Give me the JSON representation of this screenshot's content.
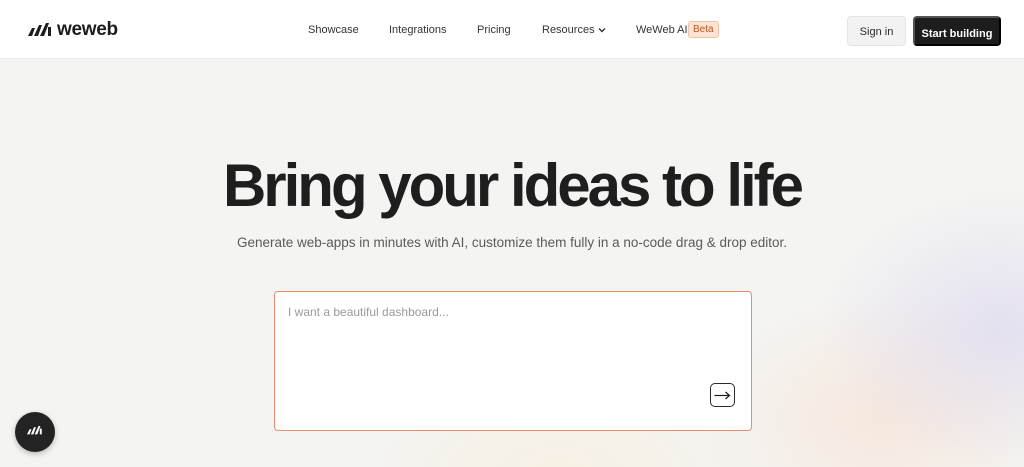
{
  "brand": {
    "name": "weweb",
    "color": "#1d1d1d"
  },
  "nav": {
    "items": [
      {
        "label": "Showcase"
      },
      {
        "label": "Integrations"
      },
      {
        "label": "Pricing"
      },
      {
        "label": "Resources",
        "icon": "chevron-down-icon"
      },
      {
        "label": "WeWeb AI",
        "badge": "Beta"
      }
    ]
  },
  "header": {
    "signin_label": "Sign in",
    "start_label": "Start building"
  },
  "hero": {
    "title": "Bring your ideas to life",
    "subtitle": "Generate web-apps in minutes with AI, customize them fully in a no-code drag & drop editor."
  },
  "prompt": {
    "placeholder": "I want a beautiful dashboard...",
    "value": "",
    "submit_icon": "arrow-right-icon",
    "accent_color": "#e98d6e"
  },
  "chat_widget": {
    "icon": "weweb-logo-icon"
  }
}
